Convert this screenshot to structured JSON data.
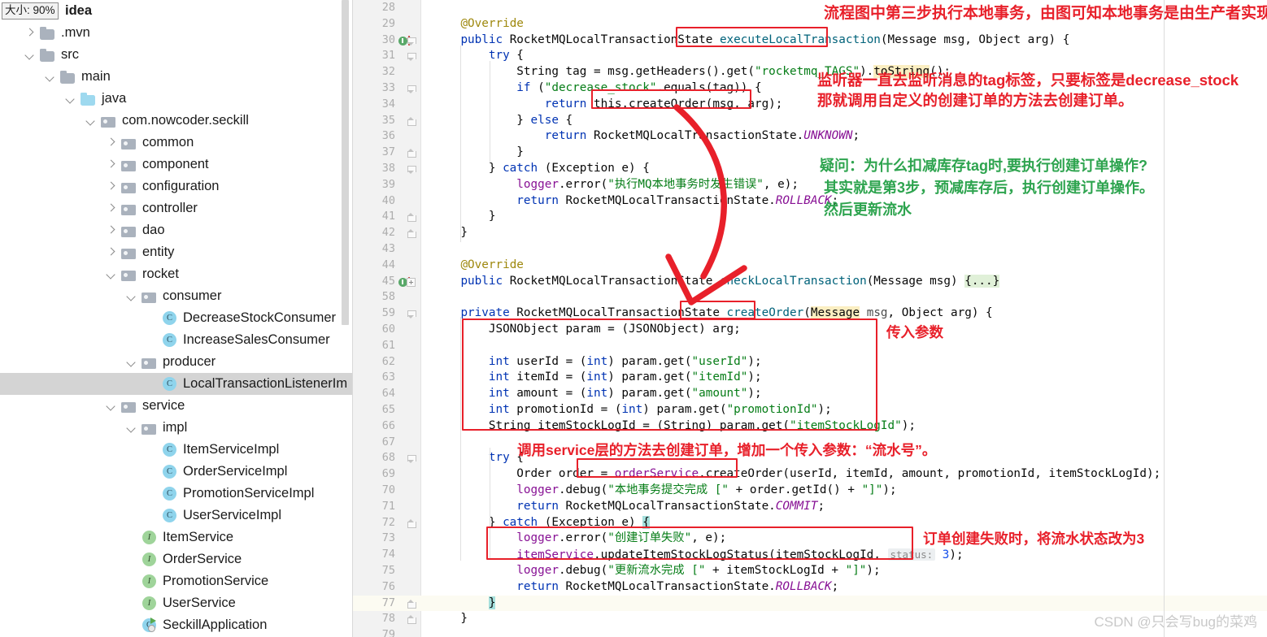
{
  "window": {
    "zoom_chip": "大小: 90%",
    "root_label": "idea",
    "watermark": "CSDN @只会写bug的菜鸡"
  },
  "sidebar": {
    "items": [
      {
        "label": ".mvn",
        "depth": 1,
        "arrow": "right",
        "icon": "folder",
        "selected": false
      },
      {
        "label": "src",
        "depth": 1,
        "arrow": "down",
        "icon": "folder",
        "selected": false
      },
      {
        "label": "main",
        "depth": 2,
        "arrow": "down",
        "icon": "folder",
        "selected": false
      },
      {
        "label": "java",
        "depth": 3,
        "arrow": "down",
        "icon": "folder-blue",
        "selected": false
      },
      {
        "label": "com.nowcoder.seckill",
        "depth": 4,
        "arrow": "down",
        "icon": "pkg",
        "selected": false
      },
      {
        "label": "common",
        "depth": 5,
        "arrow": "right",
        "icon": "pkg",
        "selected": false
      },
      {
        "label": "component",
        "depth": 5,
        "arrow": "right",
        "icon": "pkg",
        "selected": false
      },
      {
        "label": "configuration",
        "depth": 5,
        "arrow": "right",
        "icon": "pkg",
        "selected": false
      },
      {
        "label": "controller",
        "depth": 5,
        "arrow": "right",
        "icon": "pkg",
        "selected": false
      },
      {
        "label": "dao",
        "depth": 5,
        "arrow": "right",
        "icon": "pkg",
        "selected": false
      },
      {
        "label": "entity",
        "depth": 5,
        "arrow": "right",
        "icon": "pkg",
        "selected": false
      },
      {
        "label": "rocket",
        "depth": 5,
        "arrow": "down",
        "icon": "pkg",
        "selected": false
      },
      {
        "label": "consumer",
        "depth": 6,
        "arrow": "down",
        "icon": "pkg",
        "selected": false
      },
      {
        "label": "DecreaseStockConsumer",
        "depth": 7,
        "arrow": "none",
        "icon": "class",
        "selected": false
      },
      {
        "label": "IncreaseSalesConsumer",
        "depth": 7,
        "arrow": "none",
        "icon": "class",
        "selected": false
      },
      {
        "label": "producer",
        "depth": 6,
        "arrow": "down",
        "icon": "pkg",
        "selected": false
      },
      {
        "label": "LocalTransactionListenerIm",
        "depth": 7,
        "arrow": "none",
        "icon": "class",
        "selected": true
      },
      {
        "label": "service",
        "depth": 5,
        "arrow": "down",
        "icon": "pkg",
        "selected": false
      },
      {
        "label": "impl",
        "depth": 6,
        "arrow": "down",
        "icon": "pkg",
        "selected": false
      },
      {
        "label": "ItemServiceImpl",
        "depth": 7,
        "arrow": "none",
        "icon": "class",
        "selected": false
      },
      {
        "label": "OrderServiceImpl",
        "depth": 7,
        "arrow": "none",
        "icon": "class",
        "selected": false
      },
      {
        "label": "PromotionServiceImpl",
        "depth": 7,
        "arrow": "none",
        "icon": "class",
        "selected": false
      },
      {
        "label": "UserServiceImpl",
        "depth": 7,
        "arrow": "none",
        "icon": "class",
        "selected": false
      },
      {
        "label": "ItemService",
        "depth": 6,
        "arrow": "none",
        "icon": "interface",
        "selected": false
      },
      {
        "label": "OrderService",
        "depth": 6,
        "arrow": "none",
        "icon": "interface",
        "selected": false
      },
      {
        "label": "PromotionService",
        "depth": 6,
        "arrow": "none",
        "icon": "interface",
        "selected": false
      },
      {
        "label": "UserService",
        "depth": 6,
        "arrow": "none",
        "icon": "interface",
        "selected": false
      },
      {
        "label": "SeckillApplication",
        "depth": 6,
        "arrow": "none",
        "icon": "app",
        "selected": false
      }
    ]
  },
  "editor": {
    "lines": [
      {
        "n": "28",
        "code": ""
      },
      {
        "n": "29",
        "code": "    @Override"
      },
      {
        "n": "30",
        "code": "    public RocketMQLocalTransactionState executeLocalTransaction(Message msg, Object arg) {"
      },
      {
        "n": "31",
        "code": "        try {"
      },
      {
        "n": "32",
        "code": "            String tag = msg.getHeaders().get(\"rocketmq_TAGS\").toString();"
      },
      {
        "n": "33",
        "code": "            if (\"decrease_stock\".equals(tag)) {"
      },
      {
        "n": "34",
        "code": "                return this.createOrder(msg, arg);"
      },
      {
        "n": "35",
        "code": "            } else {"
      },
      {
        "n": "36",
        "code": "                return RocketMQLocalTransactionState.UNKNOWN;"
      },
      {
        "n": "37",
        "code": "            }"
      },
      {
        "n": "38",
        "code": "        } catch (Exception e) {"
      },
      {
        "n": "39",
        "code": "            logger.error(\"执行MQ本地事务时发生错误\", e);"
      },
      {
        "n": "40",
        "code": "            return RocketMQLocalTransactionState.ROLLBACK;"
      },
      {
        "n": "41",
        "code": "        }"
      },
      {
        "n": "42",
        "code": "    }"
      },
      {
        "n": "43",
        "code": ""
      },
      {
        "n": "44",
        "code": "    @Override"
      },
      {
        "n": "45",
        "code": "    public RocketMQLocalTransactionState checkLocalTransaction(Message msg) {...}"
      },
      {
        "n": "58",
        "code": ""
      },
      {
        "n": "59",
        "code": "    private RocketMQLocalTransactionState createOrder(Message msg, Object arg) {"
      },
      {
        "n": "60",
        "code": "        JSONObject param = (JSONObject) arg;"
      },
      {
        "n": "61",
        "code": ""
      },
      {
        "n": "62",
        "code": "        int userId = (int) param.get(\"userId\");"
      },
      {
        "n": "63",
        "code": "        int itemId = (int) param.get(\"itemId\");"
      },
      {
        "n": "64",
        "code": "        int amount = (int) param.get(\"amount\");"
      },
      {
        "n": "65",
        "code": "        int promotionId = (int) param.get(\"promotionId\");"
      },
      {
        "n": "66",
        "code": "        String itemStockLogId = (String) param.get(\"itemStockLogId\");"
      },
      {
        "n": "67",
        "code": ""
      },
      {
        "n": "68",
        "code": "        try {"
      },
      {
        "n": "69",
        "code": "            Order order = orderService.createOrder(userId, itemId, amount, promotionId, itemStockLogId);"
      },
      {
        "n": "70",
        "code": "            logger.debug(\"本地事务提交完成 [\" + order.getId() + \"]\");"
      },
      {
        "n": "71",
        "code": "            return RocketMQLocalTransactionState.COMMIT;"
      },
      {
        "n": "72",
        "code": "        } catch (Exception e) {"
      },
      {
        "n": "73",
        "code": "            logger.error(\"创建订单失败\", e);"
      },
      {
        "n": "74",
        "code": "            itemService.updateItemStockLogStatus(itemStockLogId, status: 3);"
      },
      {
        "n": "75",
        "code": "            logger.debug(\"更新流水完成 [\" + itemStockLogId + \"]\");"
      },
      {
        "n": "76",
        "code": "            return RocketMQLocalTransactionState.ROLLBACK;"
      },
      {
        "n": "77",
        "code": "        }"
      },
      {
        "n": "78",
        "code": "    }"
      },
      {
        "n": "79",
        "code": ""
      }
    ],
    "param_hint_label": "status:",
    "param_hint_value": "3"
  },
  "annotations": {
    "note1": "流程图中第三步执行本地事务，由图可知本地事务是由生产者实现",
    "note2_line1": "监听器一直去监听消息的tag标签，只要标签是decrease_stock",
    "note2_line2": "那就调用自定义的创建订单的方法去创建订单。",
    "note3_line1": "疑问：为什么扣减库存tag时,要执行创建订单操作?",
    "note3_line2": "其实就是第3步，预减库存后，执行创建订单操作。",
    "note3_line3": "然后更新流水",
    "note4": "传入参数",
    "note5": "调用service层的方法去创建订单，增加一个传入参数：“流水号”。",
    "note6": "订单创建失败时，将流水状态改为3"
  },
  "colors": {
    "annotation_red": "#e8202a",
    "annotation_green": "#2ea44f",
    "selection": "#d4d4d4",
    "keyword": "#0033b3",
    "string": "#067d17"
  }
}
